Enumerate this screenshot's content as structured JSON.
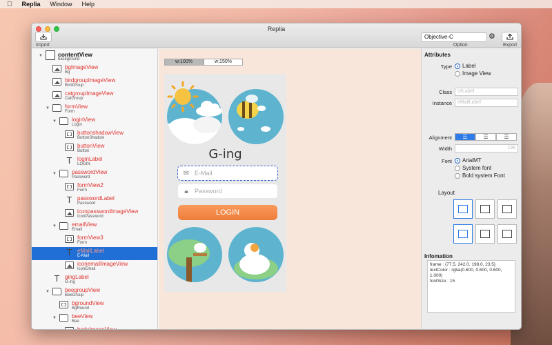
{
  "menubar": {
    "app": "Replia",
    "items": [
      "Window",
      "Help"
    ]
  },
  "window": {
    "title": "Replia"
  },
  "toolbar": {
    "import_label": "Import",
    "option_label": "Option",
    "export_label": "Export",
    "language": "Objective-C"
  },
  "tree": [
    {
      "name": "contentView",
      "sub": "background",
      "icon": "root",
      "disc": "▼",
      "level": 0
    },
    {
      "name": "bgImageView",
      "sub": "Bg",
      "icon": "image",
      "level": 1
    },
    {
      "name": "birdgroupImageView",
      "sub": "BirdGroup",
      "icon": "image",
      "level": 1
    },
    {
      "name": "catgroupImageView",
      "sub": "CatGroup",
      "icon": "image",
      "level": 1
    },
    {
      "name": "formView",
      "sub": "Form",
      "icon": "folder",
      "disc": "▼",
      "level": 1
    },
    {
      "name": "loginView",
      "sub": "Login",
      "icon": "folder",
      "disc": "▼",
      "level": 2
    },
    {
      "name": "buttonshadowView",
      "sub": "ButtonShadow",
      "icon": "view",
      "level": 3
    },
    {
      "name": "buttonView",
      "sub": "Button",
      "icon": "view",
      "level": 3
    },
    {
      "name": "loginLabel",
      "sub": "LOGIN",
      "icon": "text",
      "level": 3
    },
    {
      "name": "passwordView",
      "sub": "Password",
      "icon": "folder",
      "disc": "▼",
      "level": 2
    },
    {
      "name": "formView2",
      "sub": "Form",
      "icon": "view",
      "level": 3
    },
    {
      "name": "passwordLabel",
      "sub": "Password",
      "icon": "text",
      "level": 3
    },
    {
      "name": "iconpasswordImageView",
      "sub": "IconPassword",
      "icon": "image",
      "level": 3
    },
    {
      "name": "emailView",
      "sub": "Email",
      "icon": "folder",
      "disc": "▼",
      "level": 2
    },
    {
      "name": "formView3",
      "sub": "Form",
      "icon": "view",
      "level": 3
    },
    {
      "name": "eMailLabel",
      "sub": "E-Mail",
      "icon": "text",
      "level": 3,
      "selected": true
    },
    {
      "name": "iconemailImageView",
      "sub": "IconEmail",
      "icon": "image",
      "level": 3
    },
    {
      "name": "gingLabel",
      "sub": "G-ing",
      "icon": "text",
      "level": 1
    },
    {
      "name": "beegroupView",
      "sub": "BeeGroup",
      "icon": "folder",
      "disc": "▼",
      "level": 1
    },
    {
      "name": "bgroundView",
      "sub": "BgRound",
      "icon": "view",
      "level": 2
    },
    {
      "name": "beeView",
      "sub": "Bee",
      "icon": "folder",
      "disc": "▼",
      "level": 2
    },
    {
      "name": "bodyImageView",
      "sub": "",
      "icon": "image",
      "level": 3
    }
  ],
  "canvas": {
    "zoom_options": [
      "w:100%",
      "w:150%"
    ],
    "zoom_active": 0,
    "app_title": "G-ing",
    "email_placeholder": "E-Mail",
    "password_placeholder": "Password",
    "login_label": "LOGIN"
  },
  "attributes": {
    "section_title": "Attributes",
    "type_label": "Type",
    "type_options": [
      "Label",
      "Image View"
    ],
    "type_selected": 0,
    "class_label": "Class",
    "class_value": "UILabel",
    "instance_label": "Instance",
    "instance_value": "eMailLabel",
    "alignment_label": "Alignment",
    "alignment_selected": 0,
    "width_label": "Width",
    "width_value": "198",
    "font_label": "Font",
    "font_options": [
      "ArialMT",
      "System font",
      "Bold system Font"
    ],
    "font_selected": 0,
    "layout_title": "Layout",
    "info_title": "Infomation",
    "info_text": "frame : {77.5, 242.0, 198.0, 23.5}\ntextColor : rgba(0.600, 0.600, 0.600,\n1.000)\nfontSize : 15"
  },
  "colors": {
    "accent": "#2f7be8",
    "tree_name": "#e0312d",
    "login_button": "#ef7d3b",
    "scene_blue": "#5eb4cf"
  }
}
